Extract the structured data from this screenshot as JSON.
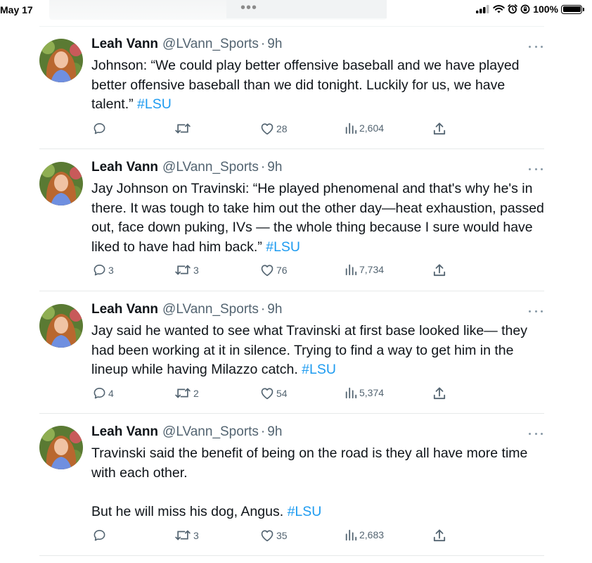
{
  "status_bar": {
    "date": "May 17",
    "battery": "100%",
    "battery_level": 1.0
  },
  "tweets": [
    {
      "name": "Leah Vann",
      "handle": "@LVann_Sports",
      "separator": "·",
      "time": "9h",
      "paragraphs": [
        {
          "text": "Johnson: “We could play better offensive baseball and we have played better offensive baseball than we did tonight. Luckily for us, we have talent.” ",
          "hashtag": "#LSU"
        }
      ],
      "replies": "",
      "retweets": "",
      "likes": "28",
      "views": "2,604"
    },
    {
      "name": "Leah Vann",
      "handle": "@LVann_Sports",
      "separator": "·",
      "time": "9h",
      "paragraphs": [
        {
          "text": "Jay Johnson on Travinski: “He played phenomenal and that's why he's in there. It was tough to take him out the other day—heat exhaustion, passed out, face down puking, IVs — the whole thing because I sure would have liked to have had him back.” ",
          "hashtag": "#LSU"
        }
      ],
      "replies": "3",
      "retweets": "3",
      "likes": "76",
      "views": "7,734"
    },
    {
      "name": "Leah Vann",
      "handle": "@LVann_Sports",
      "separator": "·",
      "time": "9h",
      "paragraphs": [
        {
          "text": "Jay said he wanted to see what Travinski at first base looked like— they had been working at it in silence. Trying to find a way to get him in the lineup while having Milazzo catch. ",
          "hashtag": "#LSU"
        }
      ],
      "replies": "4",
      "retweets": "2",
      "likes": "54",
      "views": "5,374"
    },
    {
      "name": "Leah Vann",
      "handle": "@LVann_Sports",
      "separator": "·",
      "time": "9h",
      "paragraphs": [
        {
          "text": "Travinski said the benefit of being on the road is they all have more time with each other.",
          "hashtag": ""
        },
        {
          "text": "But he will miss his dog, Angus. ",
          "hashtag": "#LSU"
        }
      ],
      "replies": "",
      "retweets": "3",
      "likes": "35",
      "views": "2,683"
    }
  ],
  "colors": {
    "hashtag": "#1d9bf0",
    "secondary_text": "#536471",
    "primary_text": "#0f1419"
  },
  "icons": [
    "reply-icon",
    "retweet-icon",
    "like-icon",
    "views-icon",
    "share-icon",
    "more-icon",
    "signal-icon",
    "wifi-icon",
    "alarm-icon",
    "lock-rotation-icon",
    "battery-icon"
  ]
}
